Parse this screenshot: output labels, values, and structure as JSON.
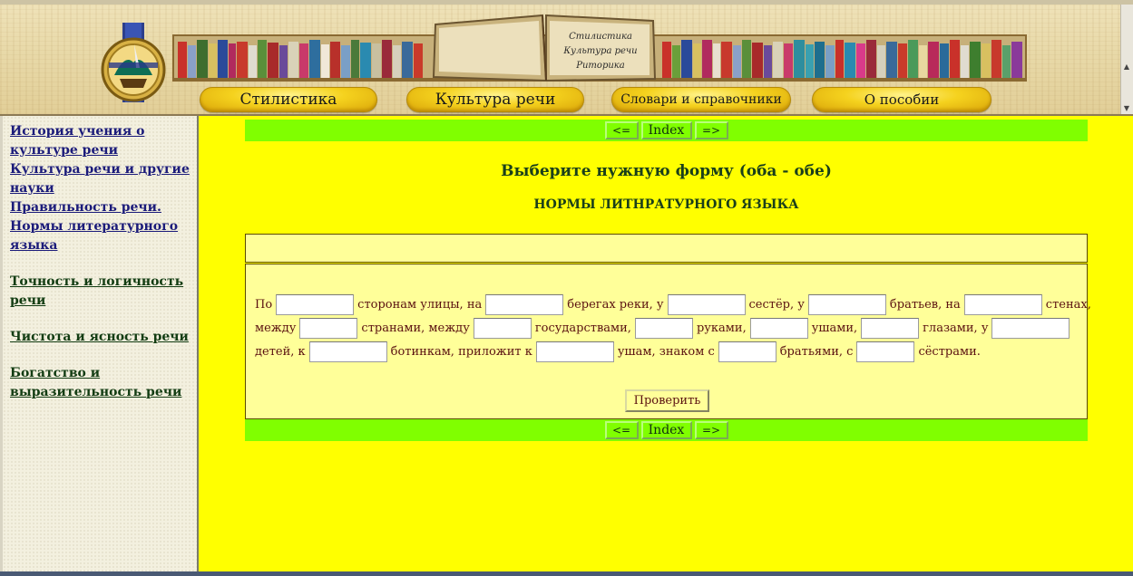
{
  "header": {
    "open_book_lines": [
      "Стилистика",
      "Культура речи",
      "Риторика"
    ],
    "nav": [
      {
        "label": "Стилистика"
      },
      {
        "label": "Культура речи"
      },
      {
        "label": "Словари и справочники"
      },
      {
        "label": "О пособии"
      }
    ]
  },
  "sidebar": {
    "links": [
      "История учения о культуре речи",
      "Культура речи и другие науки",
      "Правильность речи. Нормы литературного языка",
      "Точность и логичность речи",
      "Чистота и ясность речи",
      "Богатство и выразительность речи"
    ]
  },
  "pager": {
    "prev_label": "<=",
    "index_label": "Index",
    "next_label": "=>"
  },
  "main": {
    "title": "Выберите нужную форму (оба - обе)",
    "subtitle": "НОРМЫ ЛИТНРАТУРНОГО ЯЗЫКА",
    "exercise": {
      "line1": [
        "По",
        "сторонам улицы, на",
        "берегах реки, у",
        "сестёр, у",
        "братьев, на",
        "стенах,"
      ],
      "line2": [
        "между",
        "странами, между",
        "государствами,",
        "руками,",
        "ушами,",
        "глазами, у"
      ],
      "line3": [
        "детей, к",
        "ботинкам, приложит к",
        "ушам, знаком с",
        "братьями, с",
        "сёстрами."
      ],
      "inputs": [
        "",
        "",
        "",
        "",
        "",
        "",
        "",
        "",
        "",
        "",
        "",
        "",
        "",
        "",
        "",
        "",
        ""
      ]
    },
    "check_label": "Проверить"
  },
  "colors": {
    "main_bg": "#ffff00",
    "nav_bar": "#80ff00",
    "exercise_bg": "#ffff99",
    "sidebar_link": "#1b1b7a",
    "button_gold": "#f5d21e"
  },
  "icons": [
    "logo-emblem",
    "bookshelf-banner",
    "open-book-illustration",
    "scroll-up-icon",
    "scroll-down-icon"
  ]
}
